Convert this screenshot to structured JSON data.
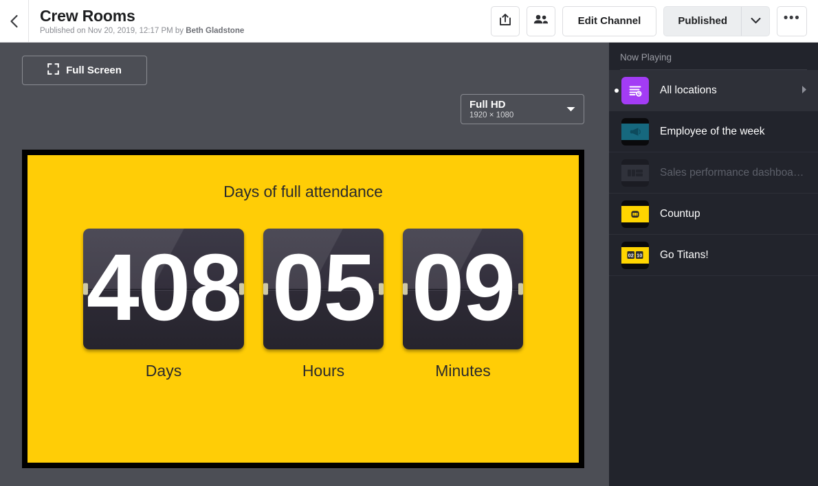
{
  "header": {
    "back_icon": "chevron-left-icon",
    "title": "Crew Rooms",
    "subtitle_prefix": "Published on Nov 20, 2019, 12:17 PM by ",
    "author": "Beth Gladstone",
    "share_icon": "share-upload-icon",
    "people_icon": "people-icon",
    "edit_channel_label": "Edit Channel",
    "status_label": "Published",
    "status_caret_icon": "chevron-down-icon",
    "more_label": "•••",
    "more_icon": "ellipsis-icon"
  },
  "stage": {
    "fullscreen_label": "Full Screen",
    "fullscreen_icon": "expand-icon",
    "resolution": {
      "name": "Full HD",
      "dimensions": "1920 × 1080",
      "caret_icon": "caret-down-icon"
    },
    "background_color": "#4c4e55"
  },
  "preview": {
    "background_color": "#ffcd06",
    "frame_color": "#000000",
    "title": "Days of full attendance",
    "units": [
      {
        "value": "408",
        "label": "Days",
        "width": "w3"
      },
      {
        "value": "05",
        "label": "Hours",
        "width": "w2"
      },
      {
        "value": "09",
        "label": "Minutes",
        "width": "w2"
      }
    ]
  },
  "sidebar": {
    "heading": "Now Playing",
    "background_color": "#22242c",
    "items": [
      {
        "label": "All locations",
        "thumb_icon": "playlist-clock-icon",
        "thumb_color": "#a33cf5",
        "selected": true,
        "disabled": false,
        "chevron_icon": "chevron-right-icon"
      },
      {
        "label": "Employee of the week",
        "thumb_icon": "megaphone-icon",
        "thumb_color": "#16687e",
        "selected": false,
        "disabled": false,
        "chevron_icon": ""
      },
      {
        "label": "Sales performance dashboard....",
        "thumb_icon": "dashboard-icon",
        "thumb_color": "#3a3d46",
        "selected": false,
        "disabled": true,
        "chevron_icon": ""
      },
      {
        "label": "Countup",
        "thumb_icon": "counter-icon",
        "thumb_color": "#ffd500",
        "selected": false,
        "disabled": false,
        "chevron_icon": ""
      },
      {
        "label": "Go Titans!",
        "thumb_icon": "flip-digits-icon",
        "thumb_color": "#ffd500",
        "selected": false,
        "disabled": false,
        "chevron_icon": ""
      }
    ]
  }
}
